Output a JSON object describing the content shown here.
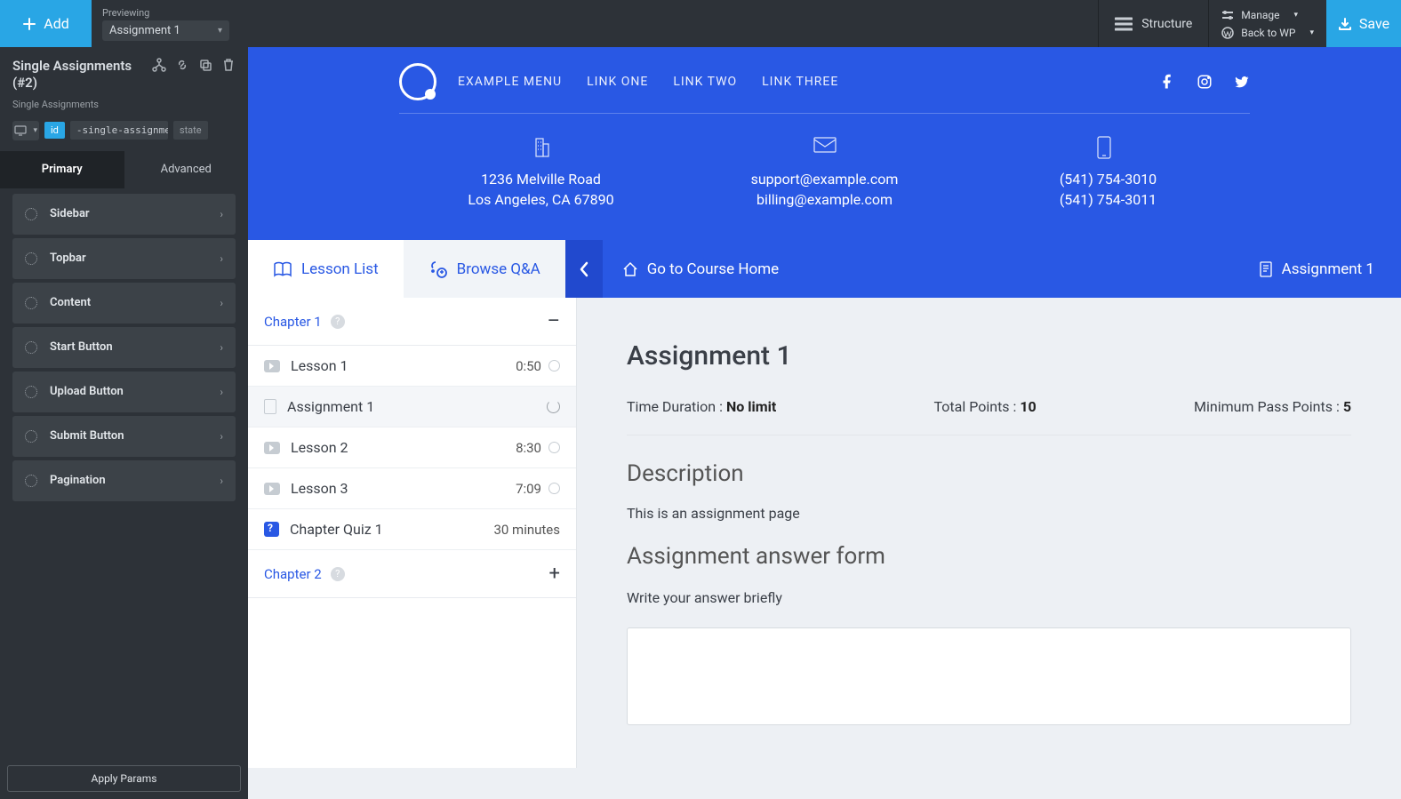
{
  "topbar": {
    "addLabel": "Add",
    "previewingLabel": "Previewing",
    "previewingValue": "Assignment 1",
    "structureLabel": "Structure",
    "manageLabel": "Manage",
    "backToWpLabel": "Back to WP",
    "saveLabel": "Save"
  },
  "builderSidebar": {
    "title": "Single Assignments (#2)",
    "subtitle": "Single Assignments",
    "idChip": "id",
    "idValue": "-single-assignmen",
    "stateChip": "state",
    "tabs": {
      "primary": "Primary",
      "advanced": "Advanced"
    },
    "sections": [
      "Sidebar",
      "Topbar",
      "Content",
      "Start Button",
      "Upload Button",
      "Submit Button",
      "Pagination"
    ],
    "applyParams": "Apply Params"
  },
  "hero": {
    "nav": [
      "EXAMPLE MENU",
      "LINK ONE",
      "LINK TWO",
      "LINK THREE"
    ],
    "info": {
      "address1": "1236 Melville Road",
      "address2": "Los Angeles, CA 67890",
      "email1": "support@example.com",
      "email2": "billing@example.com",
      "phone1": "(541) 754-3010",
      "phone2": "(541) 754-3011"
    }
  },
  "courseBar": {
    "lessonListLabel": "Lesson List",
    "browseLabel": "Browse Q&A",
    "courseHomeLabel": "Go to Course Home",
    "rightLabel": "Assignment 1"
  },
  "lessonPanel": {
    "chapter1": "Chapter 1",
    "chapter2": "Chapter 2",
    "items": [
      {
        "title": "Lesson 1",
        "time": "0:50",
        "type": "video"
      },
      {
        "title": "Assignment 1",
        "time": "",
        "type": "assignment",
        "selected": true
      },
      {
        "title": "Lesson 2",
        "time": "8:30",
        "type": "video"
      },
      {
        "title": "Lesson 3",
        "time": "7:09",
        "type": "video"
      },
      {
        "title": "Chapter Quiz 1",
        "time": "30 minutes",
        "type": "quiz"
      }
    ]
  },
  "content": {
    "title": "Assignment 1",
    "timeDurationLabel": "Time Duration :",
    "timeDurationValue": "No limit",
    "totalPointsLabel": "Total Points :",
    "totalPointsValue": "10",
    "minPassLabel": "Minimum Pass Points :",
    "minPassValue": "5",
    "descHeading": "Description",
    "descText": "This is an assignment page",
    "formHeading": "Assignment answer form",
    "answerLabel": "Write your answer briefly"
  }
}
